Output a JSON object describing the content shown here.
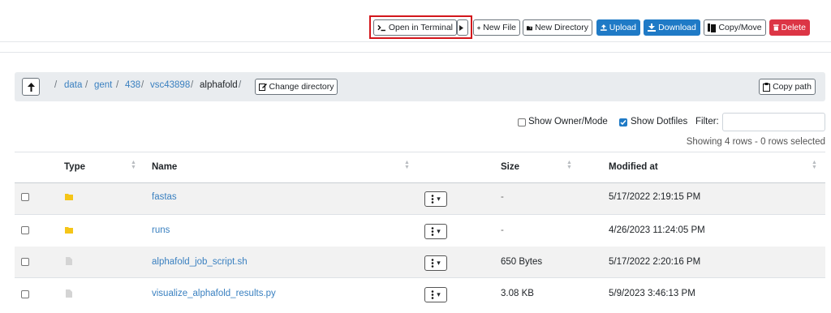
{
  "toolbar": {
    "open_terminal": "Open in Terminal",
    "new_file": "New File",
    "new_directory": "New Directory",
    "upload": "Upload",
    "download": "Download",
    "copy_move": "Copy/Move",
    "delete": "Delete"
  },
  "breadcrumb": {
    "segments": [
      "data",
      "gent",
      "438",
      "vsc43898",
      "alphafold"
    ],
    "separator": "/",
    "change_directory": "Change directory",
    "copy_path": "Copy path"
  },
  "options": {
    "show_owner_mode": "Show Owner/Mode",
    "show_owner_mode_checked": false,
    "show_dotfiles": "Show Dotfiles",
    "show_dotfiles_checked": true,
    "filter_label": "Filter:",
    "filter_value": "",
    "summary": "Showing 4 rows - 0 rows selected"
  },
  "table": {
    "columns": [
      "Type",
      "Name",
      "Size",
      "Modified at"
    ],
    "rows": [
      {
        "type": "folder",
        "name": "fastas",
        "size": "-",
        "modified": "5/17/2022 2:19:15 PM"
      },
      {
        "type": "folder",
        "name": "runs",
        "size": "-",
        "modified": "4/26/2023 11:24:05 PM"
      },
      {
        "type": "file",
        "name": "alphafold_job_script.sh",
        "size": "650 Bytes",
        "modified": "5/17/2022 2:20:16 PM"
      },
      {
        "type": "file",
        "name": "visualize_alphafold_results.py",
        "size": "3.08 KB",
        "modified": "5/9/2023 3:46:13 PM"
      }
    ]
  },
  "colors": {
    "primary": "#1f7ac6",
    "danger": "#dc3545",
    "folder": "#f5c518",
    "highlight": "#d3161b"
  }
}
